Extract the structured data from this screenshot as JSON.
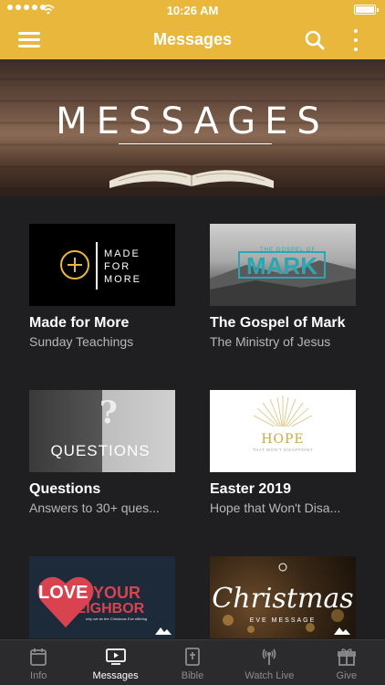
{
  "status": {
    "time": "10:26 AM"
  },
  "nav": {
    "title": "Messages"
  },
  "hero": {
    "title": "MESSAGES"
  },
  "cards": [
    {
      "title": "Made for More",
      "subtitle": "Sunday Teachings",
      "art": "MADE FOR MORE"
    },
    {
      "title": "The Gospel of Mark",
      "subtitle": "The Ministry of Jesus",
      "art_small": "THE GOSPEL OF",
      "art": "MARK"
    },
    {
      "title": "Questions",
      "subtitle": "Answers to 30+ ques...",
      "art": "QUESTIONS"
    },
    {
      "title": "Easter 2019",
      "subtitle": "Hope that Won't Disa...",
      "art": "HOPE",
      "art_small": "THAT WON'T DISAPPOINT"
    },
    {
      "art": "LOVE YOUR NEIGHBOR",
      "art_small": "why we do the Christmas Eve offering"
    },
    {
      "art": "Christmas",
      "art_small": "EVE MESSAGE"
    }
  ],
  "tabs": [
    {
      "label": "Info",
      "icon": "calendar-icon"
    },
    {
      "label": "Messages",
      "icon": "play-screen-icon",
      "active": true
    },
    {
      "label": "Bible",
      "icon": "bible-icon"
    },
    {
      "label": "Watch Live",
      "icon": "broadcast-icon"
    },
    {
      "label": "Give",
      "icon": "gift-icon"
    }
  ]
}
